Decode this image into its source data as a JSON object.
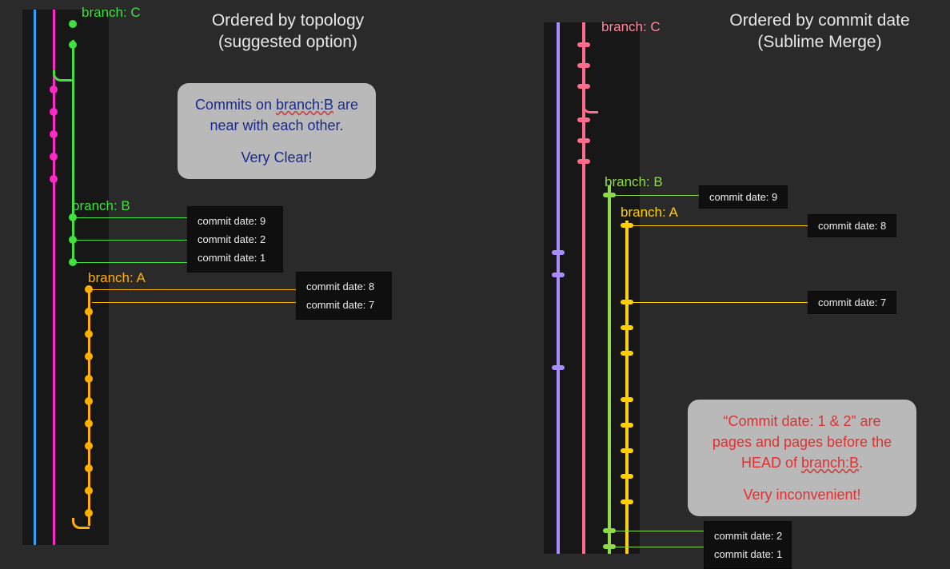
{
  "colors": {
    "blue": "#29a3ff",
    "magenta": "#ff29c7",
    "green": "#3fe03f",
    "orange": "#ffb000",
    "purple": "#a98cff",
    "pink": "#ff6b8a",
    "yellow": "#ffd000"
  },
  "left": {
    "title_line1": "Ordered by topology",
    "title_line2": "(suggested option)",
    "branches": {
      "C": "branch: C",
      "B": "branch: B",
      "A": "branch: A"
    },
    "callout": {
      "line1_pre": "Commits on ",
      "line1_under": "branch:B",
      "line1_post": " are",
      "line2": "near with each other.",
      "line3": "Very Clear!"
    },
    "commits_B": [
      "commit date: 9",
      "commit date: 2",
      "commit date: 1"
    ],
    "commits_A": [
      "commit date: 8",
      "commit date: 7"
    ]
  },
  "right": {
    "title_line1": "Ordered by commit date",
    "title_line2": "(Sublime Merge)",
    "branches": {
      "C": "branch: C",
      "B": "branch: B",
      "A": "branch: A"
    },
    "commits_top": {
      "b9": "commit date: 9",
      "a8": "commit date: 8",
      "a7": "commit date: 7"
    },
    "callout": {
      "line1": "“Commit date: 1 & 2” are",
      "line2": "pages and pages before the",
      "line3_pre": "HEAD of ",
      "line3_under": "branch:B",
      "line3_post": ".",
      "line4": "Very inconvenient!"
    },
    "commits_bottom": [
      "commit date: 2",
      "commit date: 1"
    ]
  }
}
